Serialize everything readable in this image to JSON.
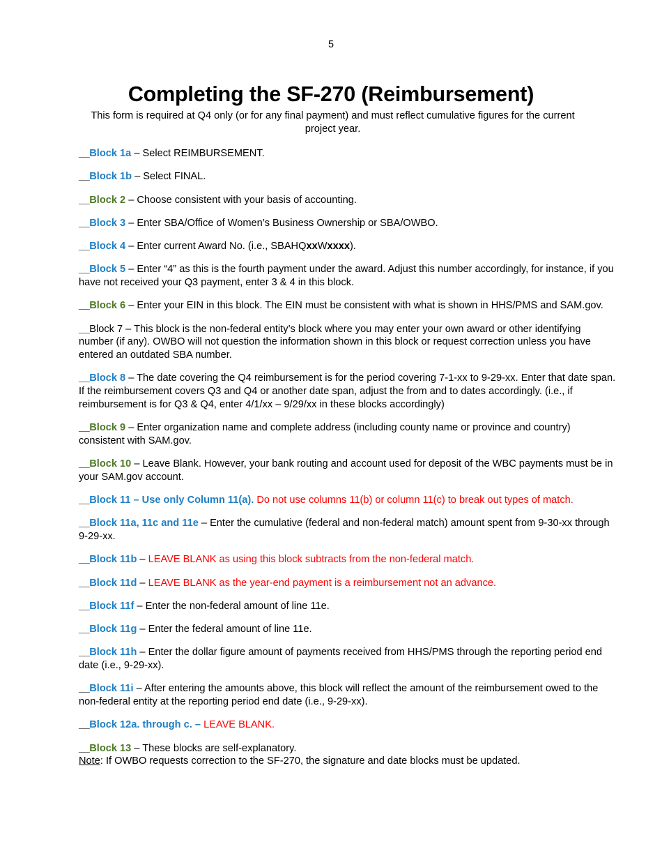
{
  "page": {
    "number": "5",
    "title": "Completing the SF-270 (Reimbursement)",
    "subtitle": "This form is required at Q4 only (or for any final payment) and must reflect cumulative figures for the current project year.",
    "marker": "__"
  },
  "colors": {
    "blue": "#1F7FC4",
    "green": "#4F7A28",
    "red": "#FF0000",
    "black": "#000000",
    "background": "#FFFFFF"
  },
  "entries": [
    {
      "id": "block-1a",
      "label": "Block 1a",
      "label_color": "blue",
      "separator": " – ",
      "text": "Select REIMBURSEMENT."
    },
    {
      "id": "block-1b",
      "label": "Block 1b",
      "label_color": "blue",
      "separator": " – ",
      "text": "Select FINAL."
    },
    {
      "id": "block-2",
      "label": "Block 2",
      "label_color": "green",
      "separator": " – ",
      "text": "Choose consistent with your basis of accounting."
    },
    {
      "id": "block-3",
      "label": "Block 3",
      "label_color": "blue",
      "separator": " – ",
      "text": "Enter SBA/Office of Women’s Business Ownership or SBA/OWBO."
    },
    {
      "id": "block-4",
      "label": "Block 4",
      "label_color": "blue",
      "separator": " – ",
      "text_pre": "Enter current Award No. (i.e., SBAHQ",
      "bold_1": "xx",
      "text_mid": "W",
      "bold_2": "xxxx",
      "text_post": ")."
    },
    {
      "id": "block-5",
      "label": "Block 5",
      "label_color": "blue",
      "separator": " – ",
      "text": "Enter “4” as this is the fourth payment under the award.  Adjust this number accordingly, for instance, if you have not received your Q3 payment, enter 3 & 4 in this block."
    },
    {
      "id": "block-6",
      "label": "Block 6",
      "label_color": "green",
      "separator": " – ",
      "text": "Enter your EIN in this block.  The EIN must be consistent with what is shown in HHS/PMS and SAM.gov."
    },
    {
      "id": "block-7",
      "label": "Block 7",
      "label_color": "black",
      "separator": " – ",
      "text": "This block is the non-federal entity’s block where you may enter your own award or other identifying number (if any).  OWBO will not question the information shown in this block or request correction unless you have entered an outdated SBA number."
    },
    {
      "id": "block-8",
      "label": "Block 8",
      "label_color": "blue",
      "separator": " – ",
      "text": "The date covering the Q4 reimbursement is for the period covering 7-1-xx to 9-29-xx.  Enter that date span.  If the reimbursement covers Q3 and Q4 or another date span, adjust the from and to dates accordingly.  (i.e., if reimbursement is for Q3 & Q4, enter 4/1/xx – 9/29/xx in these blocks accordingly)"
    },
    {
      "id": "block-9",
      "label": "Block 9",
      "label_color": "green",
      "separator": " – ",
      "text": "Enter organization name and complete address (including county name or province and country) consistent with SAM.gov."
    },
    {
      "id": "block-10",
      "label": "Block 10",
      "label_color": "green",
      "separator": " – ",
      "text": "Leave Blank.  However, your bank routing and account used for deposit of the WBC payments must be in your SAM.gov account."
    },
    {
      "id": "block-11",
      "label": "Block 11 – Use only Column 11(a)",
      "label_color": "blue",
      "separator": ".  ",
      "text": "Do not use columns 11(b) or column 11(c) to break out types of match.",
      "text_color": "red"
    },
    {
      "id": "block-11a-11c-11e",
      "label": "Block 11a, 11c and 11e",
      "label_color": "blue",
      "separator": " – ",
      "text": "Enter the cumulative (federal and non-federal match) amount spent from 9-30-xx through 9-29-xx."
    },
    {
      "id": "block-11b",
      "label": "Block 11b",
      "label_color": "blue",
      "separator": " – ",
      "text": "LEAVE BLANK as using this block subtracts from the non-federal match.",
      "text_color": "red"
    },
    {
      "id": "block-11d",
      "label": "Block 11d",
      "label_color": "blue",
      "separator": " – ",
      "text": "LEAVE BLANK as the year-end payment is a reimbursement not an advance.",
      "text_color": "red"
    },
    {
      "id": "block-11f",
      "label": "Block 11f",
      "label_color": "blue",
      "separator": " – ",
      "text": "Enter the non-federal amount of line 11e."
    },
    {
      "id": "block-11g",
      "label": "Block 11g",
      "label_color": "blue",
      "separator": " – ",
      "text": "Enter the federal amount of line 11e."
    },
    {
      "id": "block-11h",
      "label": "Block 11h",
      "label_color": "blue",
      "separator": " – ",
      "text": "Enter the dollar figure amount of payments received from HHS/PMS through the reporting period end date (i.e., 9-29-xx)."
    },
    {
      "id": "block-11i",
      "label": "Block 11i",
      "label_color": "blue",
      "separator": " – ",
      "text": "After entering the amounts above, this block will reflect the amount of the reimbursement owed to the non-federal entity at the reporting period end date (i.e., 9-29-xx)."
    },
    {
      "id": "block-12a",
      "label": "Block 12a. through c.",
      "label_color": "blue",
      "separator": " – ",
      "text": "LEAVE BLANK.",
      "text_color": "red"
    },
    {
      "id": "block-13",
      "label": "Block 13",
      "label_color": "green",
      "separator": " – ",
      "text": "These blocks are self-explanatory."
    }
  ],
  "note": {
    "label": "Note",
    "separator": ":  ",
    "text": "If OWBO requests correction to the SF-270, the signature and date blocks must be updated."
  }
}
